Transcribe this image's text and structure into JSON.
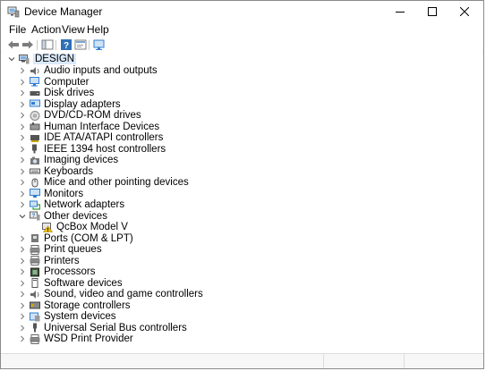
{
  "window": {
    "title": "Device Manager"
  },
  "menu": [
    "File",
    "Action",
    "View",
    "Help"
  ],
  "toolbar": {
    "buttons": [
      "back-arrow",
      "forward-arrow",
      "show-hide-tree",
      "help",
      "properties",
      "update-driver"
    ]
  },
  "tree": {
    "root": "DESIGN",
    "items": [
      {
        "label": "Audio inputs and outputs",
        "icon": "speaker-icon",
        "expanded": false
      },
      {
        "label": "Computer",
        "icon": "computer-icon",
        "expanded": false
      },
      {
        "label": "Disk drives",
        "icon": "disk-drive-icon",
        "expanded": false
      },
      {
        "label": "Display adapters",
        "icon": "display-adapter-icon",
        "expanded": false
      },
      {
        "label": "DVD/CD-ROM drives",
        "icon": "dvd-icon",
        "expanded": false
      },
      {
        "label": "Human Interface Devices",
        "icon": "hid-icon",
        "expanded": false
      },
      {
        "label": "IDE ATA/ATAPI controllers",
        "icon": "ide-controller-icon",
        "expanded": false
      },
      {
        "label": "IEEE 1394 host controllers",
        "icon": "firewire-icon",
        "expanded": false
      },
      {
        "label": "Imaging devices",
        "icon": "camera-icon",
        "expanded": false
      },
      {
        "label": "Keyboards",
        "icon": "keyboard-icon",
        "expanded": false
      },
      {
        "label": "Mice and other pointing devices",
        "icon": "mouse-icon",
        "expanded": false
      },
      {
        "label": "Monitors",
        "icon": "monitor-icon",
        "expanded": false
      },
      {
        "label": "Network adapters",
        "icon": "network-adapter-icon",
        "expanded": false
      },
      {
        "label": "Other devices",
        "icon": "other-devices-icon",
        "expanded": true,
        "children": [
          {
            "label": "QcBox Model V",
            "icon": "unknown-device-warning-icon"
          }
        ]
      },
      {
        "label": "Ports (COM & LPT)",
        "icon": "port-icon",
        "expanded": false
      },
      {
        "label": "Print queues",
        "icon": "print-queue-icon",
        "expanded": false
      },
      {
        "label": "Printers",
        "icon": "printer-icon",
        "expanded": false
      },
      {
        "label": "Processors",
        "icon": "processor-icon",
        "expanded": false
      },
      {
        "label": "Software devices",
        "icon": "software-device-icon",
        "expanded": false
      },
      {
        "label": "Sound, video and game controllers",
        "icon": "sound-controller-icon",
        "expanded": false
      },
      {
        "label": "Storage controllers",
        "icon": "storage-controller-icon",
        "expanded": false
      },
      {
        "label": "System devices",
        "icon": "system-devices-icon",
        "expanded": false
      },
      {
        "label": "Universal Serial Bus controllers",
        "icon": "usb-icon",
        "expanded": false
      },
      {
        "label": "WSD Print Provider",
        "icon": "wsd-printer-icon",
        "expanded": false
      }
    ]
  },
  "colors": {
    "selection": "#dbe9f9",
    "icon_blue": "#2f7fd1",
    "icon_gray": "#6b6b6b",
    "warning": "#e8b400"
  }
}
